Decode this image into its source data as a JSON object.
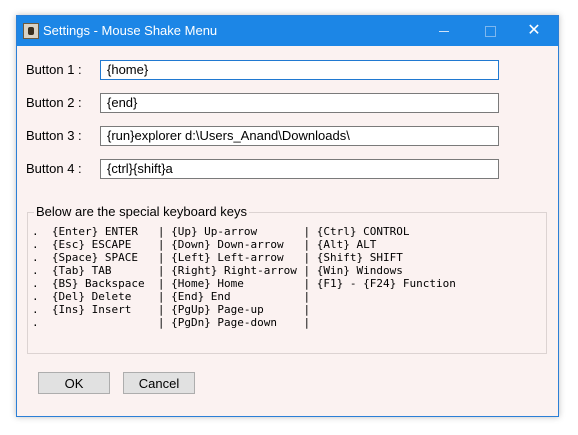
{
  "window": {
    "title": "Settings - Mouse Shake Menu",
    "close_glyph": "✕"
  },
  "buttons": [
    {
      "label": "Button 1 :",
      "value": "{home}"
    },
    {
      "label": "Button 2 :",
      "value": "{end}"
    },
    {
      "label": "Button 3 :",
      "value": "{run}explorer d:\\Users_Anand\\Downloads\\"
    },
    {
      "label": "Button 4 :",
      "value": "{ctrl}{shift}a"
    }
  ],
  "special_keys": {
    "legend": "Below are the special keyboard keys",
    "lines": [
      ".  {Enter} ENTER   | {Up} Up-arrow       | {Ctrl} CONTROL",
      ".  {Esc} ESCAPE    | {Down} Down-arrow   | {Alt} ALT",
      ".  {Space} SPACE   | {Left} Left-arrow   | {Shift} SHIFT",
      ".  {Tab} TAB       | {Right} Right-arrow | {Win} Windows",
      ".  {BS} Backspace  | {Home} Home         | {F1} - {F24} Function",
      ".  {Del} Delete    | {End} End           |",
      ".  {Ins} Insert    | {PgUp} Page-up      |",
      ".                  | {PgDn} Page-down    |"
    ]
  },
  "actions": {
    "ok_label": "OK",
    "cancel_label": "Cancel"
  },
  "colors": {
    "titlebar": "#1c86e6",
    "window_bg": "#fbf2f1"
  }
}
